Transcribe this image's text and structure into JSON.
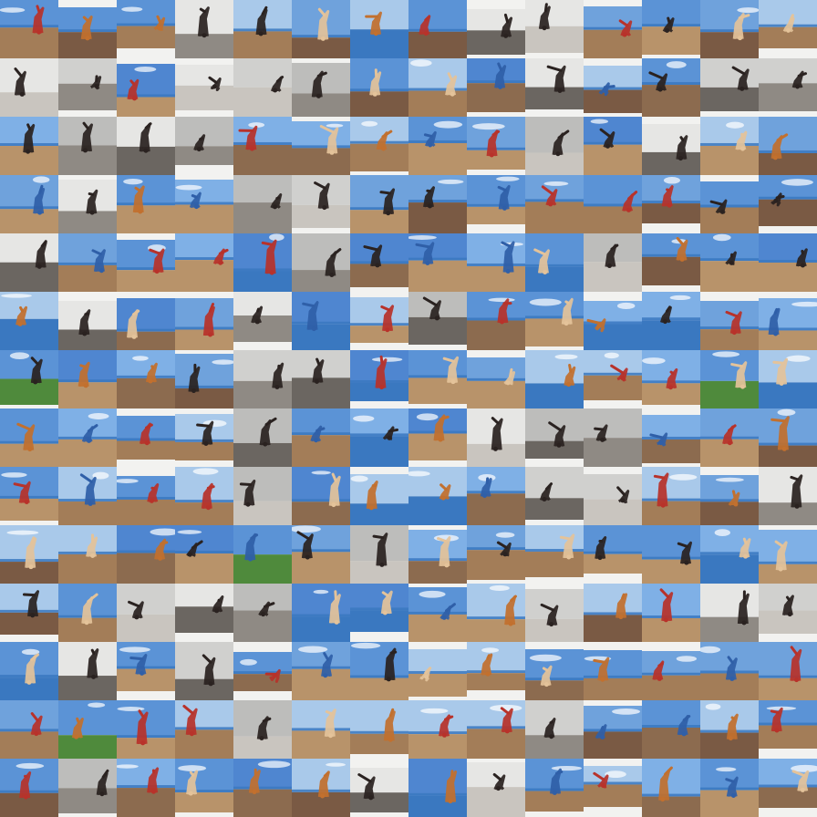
{
  "grid": {
    "rows": 14,
    "cols": 14,
    "description_kind": "generated-image-samples",
    "palettes": {
      "sky": "#5b93d6",
      "sky_light": "#a9c9ea",
      "sea": "#3a78c0",
      "sand": "#b8936a",
      "ground_dark": "#4a3a30",
      "grass": "#4f8a3c",
      "white": "#f2f2f0",
      "grey": "#9a9a98",
      "dark": "#1a1a1a",
      "figure_warm": "#c2702e",
      "figure_red": "#b8322a",
      "figure_dark": "#2a2220",
      "figure_pale": "#e4c39a"
    },
    "tile_themes": [
      "beach",
      "beach",
      "beach",
      "mono",
      "beach",
      "beach",
      "sea",
      "beach",
      "mono",
      "mono",
      "beach",
      "sky",
      "beach",
      "beach",
      "mono",
      "mono",
      "sky",
      "mono",
      "mono",
      "mono",
      "beach",
      "beach",
      "sky",
      "mono",
      "beach",
      "sky",
      "mono",
      "mono",
      "sky",
      "mono",
      "mono",
      "mono",
      "sky",
      "sky",
      "beach",
      "beach",
      "beach",
      "mono",
      "sky",
      "mono",
      "beach",
      "beach",
      "beach",
      "mono",
      "beach",
      "sky",
      "mono",
      "mono",
      "beach",
      "beach",
      "sky",
      "beach",
      "beach",
      "beach",
      "beach",
      "beach",
      "mono",
      "beach",
      "beach",
      "sky",
      "sky",
      "mono",
      "sky",
      "sky",
      "sky",
      "sky",
      "mono",
      "beach",
      "beach",
      "sky",
      "sea",
      "mono",
      "sky",
      "beach",
      "mono",
      "sky",
      "beach",
      "mono",
      "sky",
      "beach",
      "sky",
      "sky",
      "beach",
      "sky",
      "grass",
      "sky",
      "sky",
      "beach",
      "mono",
      "mono",
      "sky",
      "beach",
      "beach",
      "sea",
      "beach",
      "sky",
      "grass",
      "sea",
      "beach",
      "sky",
      "beach",
      "beach",
      "mono",
      "beach",
      "sky",
      "sky",
      "mono",
      "mono",
      "mono",
      "sky",
      "beach",
      "beach",
      "sky",
      "beach",
      "beach",
      "beach",
      "mono",
      "sky",
      "sea",
      "sea",
      "sky",
      "mono",
      "mono",
      "beach",
      "beach",
      "mono",
      "beach",
      "beach",
      "sky",
      "sky",
      "grass",
      "beach",
      "mono",
      "sky",
      "beach",
      "beach",
      "beach",
      "sky",
      "sky",
      "sky",
      "beach",
      "beach",
      "mono",
      "mono",
      "mono",
      "sky",
      "sky",
      "beach",
      "beach",
      "mono",
      "beach",
      "sky",
      "mono",
      "mono",
      "sky",
      "mono",
      "sky",
      "mono",
      "sky",
      "beach",
      "sky",
      "beach",
      "beach",
      "sky",
      "beach",
      "beach",
      "beach",
      "beach",
      "beach",
      "grass",
      "sky",
      "beach",
      "mono",
      "beach",
      "beach",
      "beach",
      "beach",
      "mono",
      "beach",
      "sky",
      "beach",
      "beach",
      "beach",
      "mono",
      "sky",
      "beach",
      "sky",
      "beach",
      "mono",
      "sky",
      "mono",
      "beach",
      "beach",
      "sky",
      "beach",
      "sky"
    ]
  }
}
